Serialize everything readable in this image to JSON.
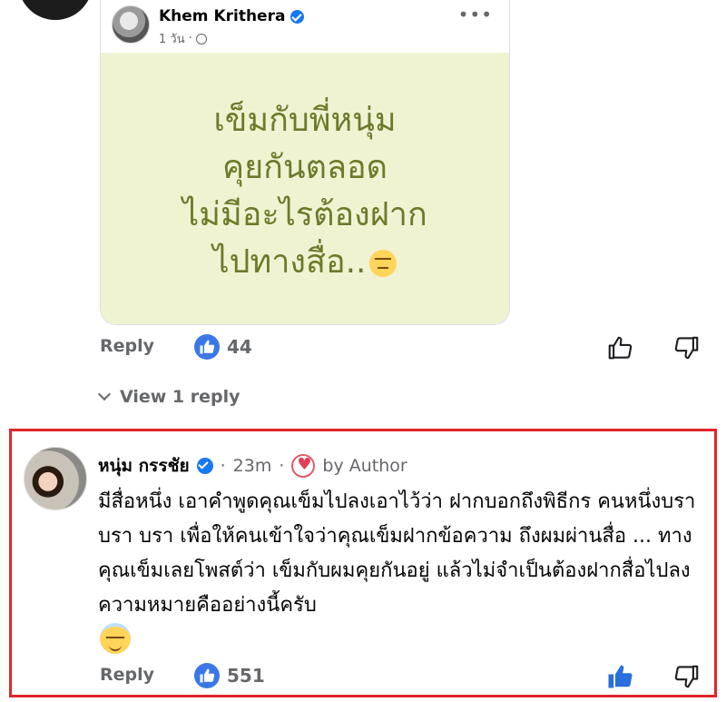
{
  "shared_post": {
    "author": "Khem Krithera",
    "time": "1 วัน",
    "body_lines": [
      "เข็มกับพี่หนุ่ม",
      "คุยกันตลอด",
      "ไม่มีอะไรต้องฝาก",
      "ไปทางสื่อ.."
    ],
    "emoji_icon": "unamused-face-emoji"
  },
  "first_actions": {
    "reply_label": "Reply",
    "like_count": "44"
  },
  "view_replies_label": "View 1 reply",
  "comment": {
    "author": "หนุ่ม กรรชัย",
    "time": "23m",
    "separator": "·",
    "author_badge": "by Author",
    "text": "มีสื่อหนึ่ง เอาคำพูดคุณเข็มไปลงเอาไว้ว่า ฝากบอกถึงพิธีกร คนหนึ่งบรา บรา บรา เพื่อให้คนเข้าใจว่าคุณเข็มฝากข้อความ ถึงผมผ่านสื่อ  ... ทางคุณเข็มเลยโพสต์ว่า เข็มกับผมคุยกันอยู่ แล้วไม่จำเป็นต้องฝากสื่อไปลง ความหมายคืออย่างนี้ครับ",
    "emoji_icon": "smiling-face-with-halo-emoji",
    "reply_label": "Reply",
    "like_count": "551"
  },
  "colors": {
    "highlight_border": "#e0262b",
    "like_blue": "#3b78e7",
    "post_background": "#f0f3d2",
    "post_text": "#6c7a2a"
  }
}
